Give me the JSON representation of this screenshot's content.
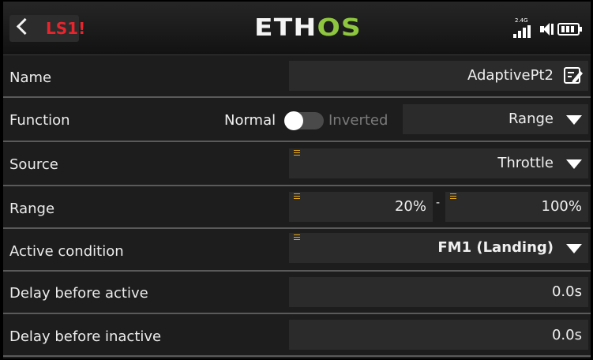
{
  "header": {
    "screen_label": "LS1!",
    "brand": {
      "part1": "ETH",
      "part2": "OS"
    },
    "radio_band": "2.4G"
  },
  "rows": {
    "name": {
      "label": "Name",
      "value": "AdaptivePt2"
    },
    "function": {
      "label": "Function",
      "option_off": "Normal",
      "option_on": "Inverted",
      "mode_value": "Range"
    },
    "source": {
      "label": "Source",
      "value": "Throttle"
    },
    "range": {
      "label": "Range",
      "min": "20%",
      "separator": "-",
      "max": "100%"
    },
    "active_condition": {
      "label": "Active condition",
      "value": "FM1 (Landing)"
    },
    "delay_active": {
      "label": "Delay before active",
      "value": "0.0s"
    },
    "delay_inactive": {
      "label": "Delay before inactive",
      "value": "0.0s"
    }
  },
  "colors": {
    "accent_red": "#e8242c",
    "brand_green": "#8ec63f",
    "marker_orange": "#e8a91a"
  },
  "icons": [
    "back-chevron",
    "signal-bars",
    "speaker",
    "battery",
    "edit",
    "dropdown-triangle"
  ]
}
